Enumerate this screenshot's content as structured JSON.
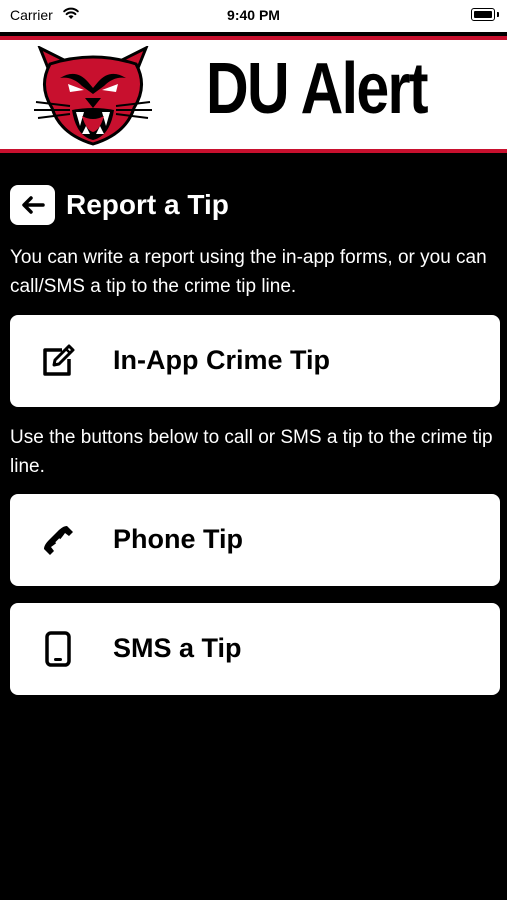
{
  "status_bar": {
    "carrier": "Carrier",
    "time": "9:40 PM"
  },
  "banner": {
    "title": "DU Alert",
    "accent_color": "#c8102e"
  },
  "header": {
    "title": "Report a Tip",
    "back_icon": "back-arrow-icon"
  },
  "intro_text": "You can write a report using the in-app forms, or you can call/SMS a tip to the crime tip line.",
  "buttons": {
    "in_app": {
      "label": "In-App Crime Tip",
      "icon": "edit-icon"
    },
    "phone": {
      "label": "Phone Tip",
      "icon": "phone-icon"
    },
    "sms": {
      "label": "SMS a Tip",
      "icon": "smartphone-icon"
    }
  },
  "call_text": "Use the buttons below to call or SMS a tip to the crime tip line."
}
